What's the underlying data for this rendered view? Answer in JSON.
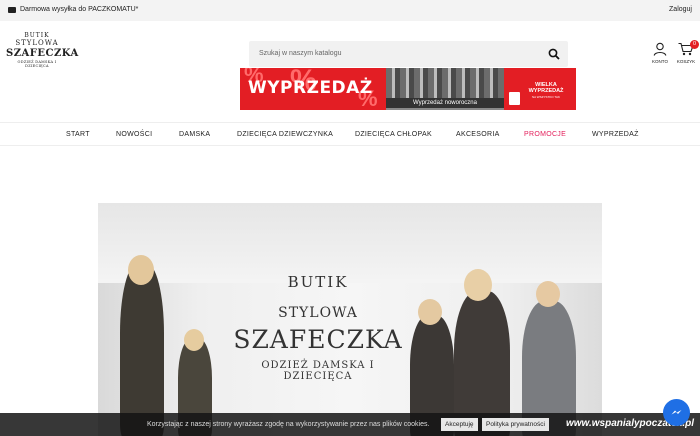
{
  "topbar": {
    "shipping_text": "Darmowa wysyłka do PACZKOMATU*",
    "login_label": "Zaloguj"
  },
  "logo": {
    "line1": "BUTIK",
    "line2": "STYLOWA",
    "line3": "SZAFECZKA",
    "line4": "ODZIEŻ DAMSKA I DZIECIĘCA"
  },
  "search": {
    "placeholder": "Szukaj w naszym katalogu"
  },
  "banners": {
    "sale_text": "WYPRZEDAŻ",
    "new_year_text": "Wyprzedaż noworoczna",
    "big_sale_text": "WIELKA WYPRZEDAŻ",
    "big_sale_sub": "NA WSZYSTKO TAK"
  },
  "account": {
    "label": "KONTO"
  },
  "cart": {
    "label": "KOSZYK",
    "count": "0"
  },
  "nav": {
    "items": [
      "START",
      "NOWOŚCI",
      "DAMSKA",
      "DZIECIĘCA DZIEWCZYNKA",
      "DZIECIĘCA CHŁOPAK",
      "AKCESORIA",
      "PROMOCJE",
      "WYPRZEDAŻ"
    ],
    "highlight_color": "#e31e5a"
  },
  "hero": {
    "line1": "BUTIK",
    "line2": "STYLOWA",
    "line3": "SZAFECZKA",
    "line4": "ODZIEŻ DAMSKA I DZIECIĘCA"
  },
  "cookie": {
    "message": "Korzystając z naszej strony wyrażasz zgodę na wykorzystywanie przez nas plików cookies.",
    "accept_label": "Akceptuję",
    "policy_label": "Polityka prywatności"
  },
  "watermark": "www.wspanialypoczatek.pl",
  "colors": {
    "brand_red": "#e31e24",
    "messenger_blue": "#1f6fe5"
  }
}
